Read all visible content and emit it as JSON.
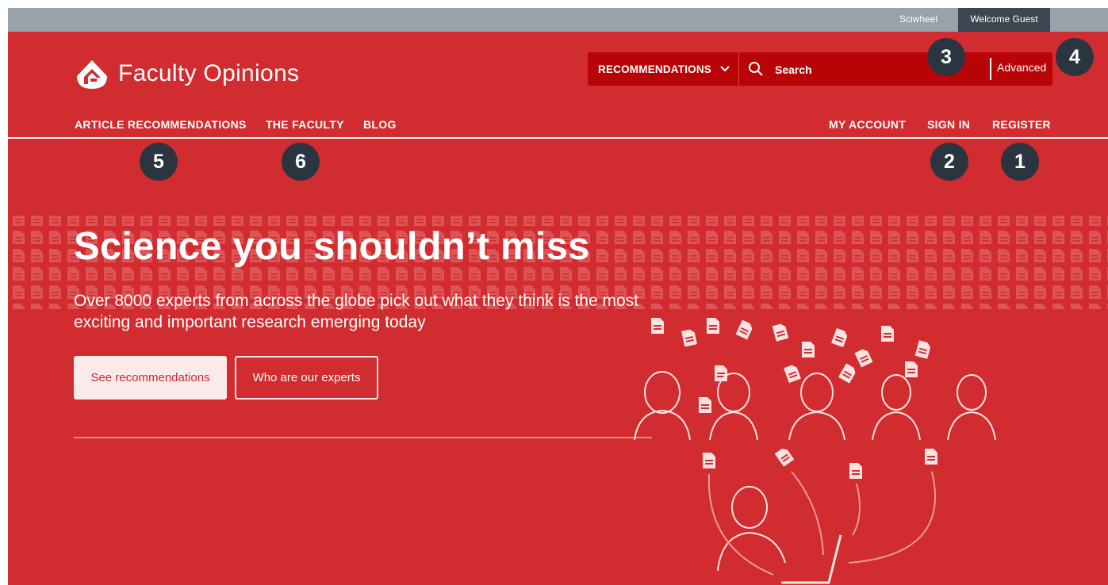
{
  "topbar": {
    "sciwheel": "Sciwheel",
    "welcome": "Welcome Guest"
  },
  "brand": {
    "name": "Faculty Opinions"
  },
  "search": {
    "scope_label": "RECOMMENDATIONS",
    "placeholder": "Search",
    "advanced_label": "Advanced"
  },
  "nav": {
    "left": [
      "ARTICLE RECOMMENDATIONS",
      "THE FACULTY",
      "BLOG"
    ],
    "right": [
      "MY ACCOUNT",
      "SIGN IN",
      "REGISTER"
    ]
  },
  "badges": [
    "1",
    "2",
    "3",
    "4",
    "5",
    "6"
  ],
  "hero": {
    "headline": "Science you shouldn’t miss",
    "subheadline": "Over 8000 experts from across the globe pick out what they think is the most exciting and important research emerging today",
    "primary_button": "See recommendations",
    "secondary_button": "Who are our experts"
  },
  "icons": [
    "logo-icon",
    "chevron-down-icon",
    "search-icon",
    "document-icon"
  ],
  "colors": {
    "brand_red": "#d12c2f",
    "search_bg": "#b80407",
    "topbar": "#98a2aa",
    "welcome_bg": "#3b4650",
    "badge": "#2b3540"
  }
}
